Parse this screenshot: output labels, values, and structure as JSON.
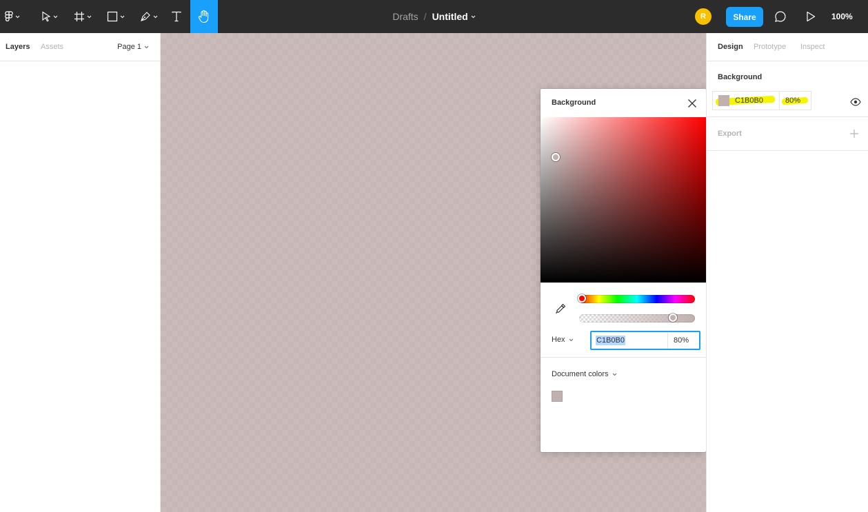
{
  "toolbar": {
    "breadcrumb_parent": "Drafts",
    "breadcrumb_separator": "/",
    "file_title": "Untitled",
    "avatar_initial": "R",
    "share_label": "Share",
    "zoom_label": "100%",
    "active_tool": "hand-tool",
    "accent_color": "#18a0fb"
  },
  "left_panel": {
    "tabs": [
      {
        "label": "Layers",
        "active": true
      },
      {
        "label": "Assets",
        "active": false
      }
    ],
    "page_label": "Page 1"
  },
  "canvas": {
    "background_hex": "#C1B0B0",
    "opacity": "80%"
  },
  "color_picker": {
    "title": "Background",
    "mode_label": "Hex",
    "hex_value": "C1B0B0",
    "alpha_value": "80%",
    "alpha_fraction": 0.8,
    "hue_color": "#ff0000",
    "document_colors_label": "Document colors",
    "document_colors": [
      "#C1B0B0"
    ]
  },
  "right_panel": {
    "tabs": [
      {
        "label": "Design",
        "active": true
      },
      {
        "label": "Prototype",
        "active": false
      },
      {
        "label": "Inspect",
        "active": false
      }
    ],
    "background_title": "Background",
    "fill_hex": "C1B0B0",
    "fill_opacity": "80%",
    "export_title": "Export",
    "highlight_color": "#f5f500"
  }
}
